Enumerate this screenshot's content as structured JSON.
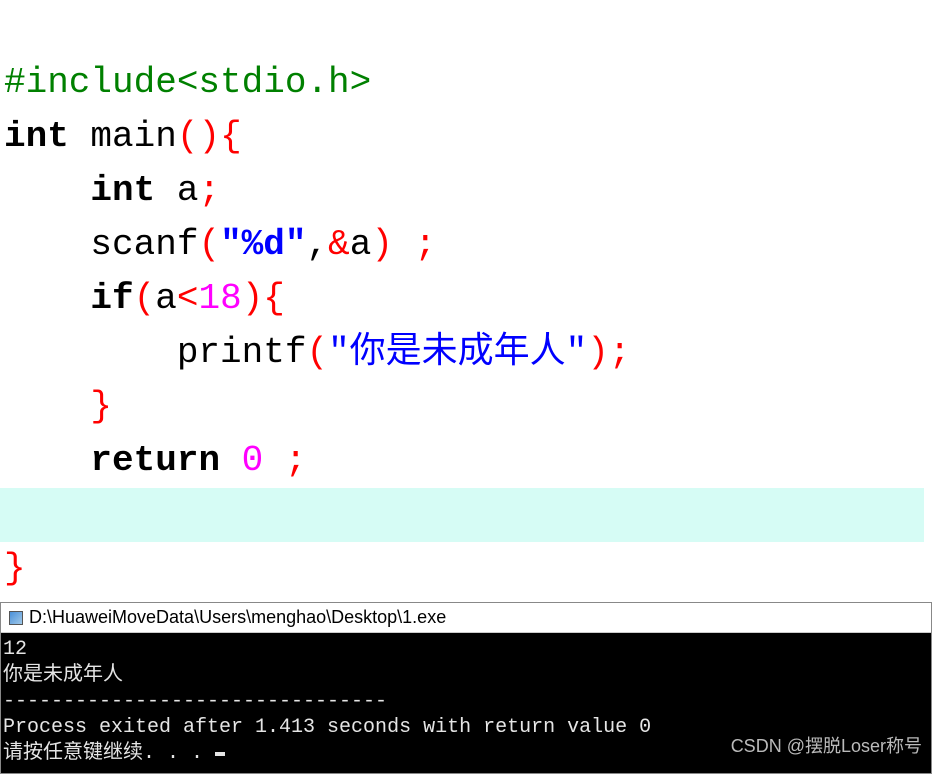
{
  "code": {
    "line1": {
      "include": "#include<stdio.h>"
    },
    "line2": {
      "int": "int",
      "main": " main",
      "lparen": "(",
      "rparen": ")",
      "lbrace": "{"
    },
    "line3": {
      "indent": "    ",
      "int": "int",
      "a": " a",
      "semi": ";"
    },
    "line4": {
      "indent": "    ",
      "scanf": "scanf",
      "lparen": "(",
      "str": "\"%d\"",
      "comma": ",",
      "amp": "&",
      "a": "a",
      "rparen": ")",
      "space": " ",
      "semi": ";"
    },
    "line5": {
      "indent": "    ",
      "if": "if",
      "lparen": "(",
      "a": "a",
      "lt": "<",
      "num": "18",
      "rparen": ")",
      "lbrace": "{"
    },
    "line6": {
      "indent": "        ",
      "printf": "printf",
      "lparen": "(",
      "str": "\"你是未成年人\"",
      "rparen": ")",
      "semi": ";"
    },
    "line7": {
      "indent": "    ",
      "rbrace": "}"
    },
    "line8": {
      "indent": "    ",
      "return": "return",
      "space": " ",
      "zero": "0",
      "space2": " ",
      "semi": ";"
    },
    "line9": {
      "blank": " "
    },
    "line10": {
      "rbrace": "}"
    }
  },
  "console": {
    "title": "D:\\HuaweiMoveData\\Users\\menghao\\Desktop\\1.exe",
    "output_input": "12",
    "output_result": "你是未成年人",
    "output_sep": "--------------------------------",
    "output_exit": "Process exited after 1.413 seconds with return value 0",
    "output_prompt": "请按任意键继续. . . "
  },
  "watermark": "CSDN @摆脱Loser称号"
}
